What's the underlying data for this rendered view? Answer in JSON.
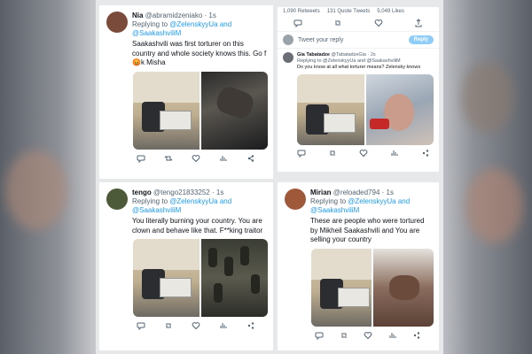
{
  "tweets": [
    {
      "name": "Nia",
      "handle": "@abramidzeniako",
      "time": "· 1s",
      "replying": "Replying to",
      "mention1": "@ZelenskyyUa and",
      "mention2": "@SaakashviliM",
      "text": "Saakashvili was first torturer on this country and whole society knows this. Go f😡k Misha",
      "avatar_color": "#7a4b3a"
    },
    {
      "name": "tengo",
      "handle": "@tengo21833252",
      "time": "· 1s",
      "replying": "Replying to",
      "mention1": "@ZelenskyyUa and",
      "mention2": "@SaakashviliM",
      "text": "You literally burning your country. You are clown and behave like that. F**king traitor",
      "avatar_color": "#4d5a3a"
    },
    {
      "name": "Mirian",
      "handle": "@reloaded794",
      "time": "· 1s",
      "replying": "Replying to",
      "mention1": "@ZelenskyyUa and",
      "mention2": "@SaakashviliM",
      "text": "These are people who were tortured by Mikheil Saakashvili and You are selling your country",
      "avatar_color": "#a0583a"
    }
  ],
  "mini": {
    "stats": [
      "1,090 Retweets",
      "131 Quote Tweets",
      "5,049 Likes"
    ],
    "compose_placeholder": "Tweet your reply",
    "reply_button": "Reply",
    "name": "Gia Tabatadze",
    "handle": "@TabatadzeGia · 2s",
    "replying": "Replying to @ZelenskyyUa and @SaakashviliM",
    "text": "Do you know at all what torturer means? Zelensky knows"
  },
  "icons": [
    "reply-icon",
    "retweet-icon",
    "like-icon",
    "views-icon",
    "share-icon"
  ],
  "colors": {
    "link": "#1d9bf0",
    "muted": "#536471",
    "text": "#0f1419"
  }
}
